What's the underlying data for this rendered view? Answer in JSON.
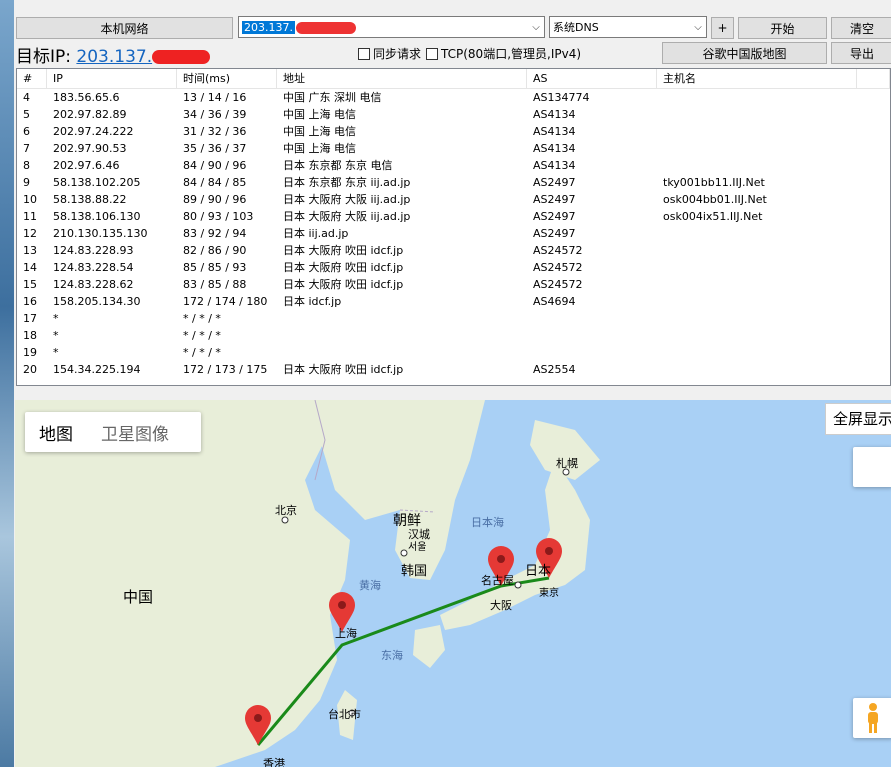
{
  "toolbar": {
    "local_network": "本机网络",
    "ip_prefix": "203.137.",
    "dns": "系统DNS",
    "plus": "+",
    "start": "开始",
    "clear": "清空",
    "target_label": "目标IP:",
    "target_ip": "203.137.",
    "sync_request": "同步请求",
    "tcp_option": "TCP(80端口,管理员,IPv4)",
    "google_map": "谷歌中国版地图",
    "export": "导出"
  },
  "table": {
    "columns": [
      "#",
      "IP",
      "时间(ms)",
      "地址",
      "AS",
      "主机名"
    ],
    "rows": [
      [
        "4",
        "183.56.65.6",
        "13 / 14 / 16",
        "中国 广东 深圳 电信",
        "AS134774",
        ""
      ],
      [
        "5",
        "202.97.82.89",
        "34 / 36 / 39",
        "中国 上海 电信",
        "AS4134",
        ""
      ],
      [
        "6",
        "202.97.24.222",
        "31 / 32 / 36",
        "中国 上海 电信",
        "AS4134",
        ""
      ],
      [
        "7",
        "202.97.90.53",
        "35 / 36 / 37",
        "中国 上海 电信",
        "AS4134",
        ""
      ],
      [
        "8",
        "202.97.6.46",
        "84 / 90 / 96",
        "日本 东京都 东京 电信",
        "AS4134",
        ""
      ],
      [
        "9",
        "58.138.102.205",
        "84 / 84 / 85",
        "日本 东京都 东京 iij.ad.jp",
        "AS2497",
        "tky001bb11.IIJ.Net"
      ],
      [
        "10",
        "58.138.88.22",
        "89 / 90 / 96",
        "日本 大阪府 大阪 iij.ad.jp",
        "AS2497",
        "osk004bb01.IIJ.Net"
      ],
      [
        "11",
        "58.138.106.130",
        "80 / 93 / 103",
        "日本 大阪府 大阪 iij.ad.jp",
        "AS2497",
        "osk004ix51.IIJ.Net"
      ],
      [
        "12",
        "210.130.135.130",
        "83 / 92 / 94",
        "日本 iij.ad.jp",
        "AS2497",
        ""
      ],
      [
        "13",
        "124.83.228.93",
        "82 / 86 / 90",
        "日本 大阪府 吹田 idcf.jp",
        "AS24572",
        ""
      ],
      [
        "14",
        "124.83.228.54",
        "85 / 85 / 93",
        "日本 大阪府 吹田 idcf.jp",
        "AS24572",
        ""
      ],
      [
        "15",
        "124.83.228.62",
        "83 / 85 / 88",
        "日本 大阪府 吹田 idcf.jp",
        "AS24572",
        ""
      ],
      [
        "16",
        "158.205.134.30",
        "172 / 174 / 180",
        "日本 idcf.jp",
        "AS4694",
        ""
      ],
      [
        "17",
        "*",
        "* / * / *",
        "",
        "",
        ""
      ],
      [
        "18",
        "*",
        "* / * / *",
        "",
        "",
        ""
      ],
      [
        "19",
        "*",
        "* / * / *",
        "",
        "",
        ""
      ],
      [
        "20",
        "154.34.225.194",
        "172 / 173 / 175",
        "日本 大阪府 吹田 idcf.jp",
        "AS2554",
        ""
      ]
    ]
  },
  "map": {
    "tab_map": "地图",
    "tab_satellite": "卫星图像",
    "fullscreen": "全屏显示",
    "labels": {
      "beijing": "北京",
      "korea": "朝鲜",
      "hancheng": "汉城",
      "seoul": "서울",
      "south_korea": "韩国",
      "japan_sea": "日本海",
      "sapporo": "札幌",
      "china": "中国",
      "yellow_sea": "黄海",
      "shanghai": "上海",
      "east_sea": "东海",
      "nagoya": "名古屋",
      "osaka": "大阪",
      "japan": "日本",
      "tokyo": "東京",
      "taipei": "台北市",
      "hongkong": "香港"
    },
    "route_color": "#1a8a1a",
    "pin_color": "#e53935"
  }
}
